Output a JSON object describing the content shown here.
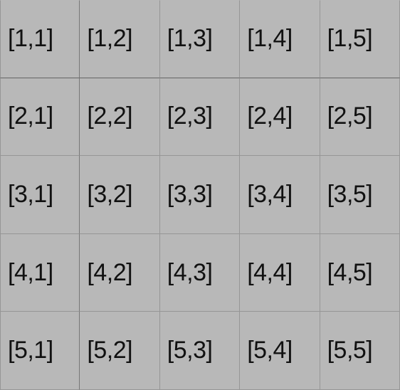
{
  "grid": {
    "rows": 5,
    "cols": 5,
    "cells": [
      [
        "[1,1]",
        "[1,2]",
        "[1,3]",
        "[1,4]",
        "[1,5]"
      ],
      [
        "[2,1]",
        "[2,2]",
        "[2,3]",
        "[2,4]",
        "[2,5]"
      ],
      [
        "[3,1]",
        "[3,2]",
        "[3,3]",
        "[3,4]",
        "[3,5]"
      ],
      [
        "[4,1]",
        "[4,2]",
        "[4,3]",
        "[4,4]",
        "[4,5]"
      ],
      [
        "[5,1]",
        "[5,2]",
        "[5,3]",
        "[5,4]",
        "[5,5]"
      ]
    ]
  },
  "colors": {
    "background": "#b8b8b8",
    "text": "#111111",
    "grid_line": "rgba(0,0,0,0.18)",
    "accent_line": "rgba(0,0,0,0.45)"
  }
}
